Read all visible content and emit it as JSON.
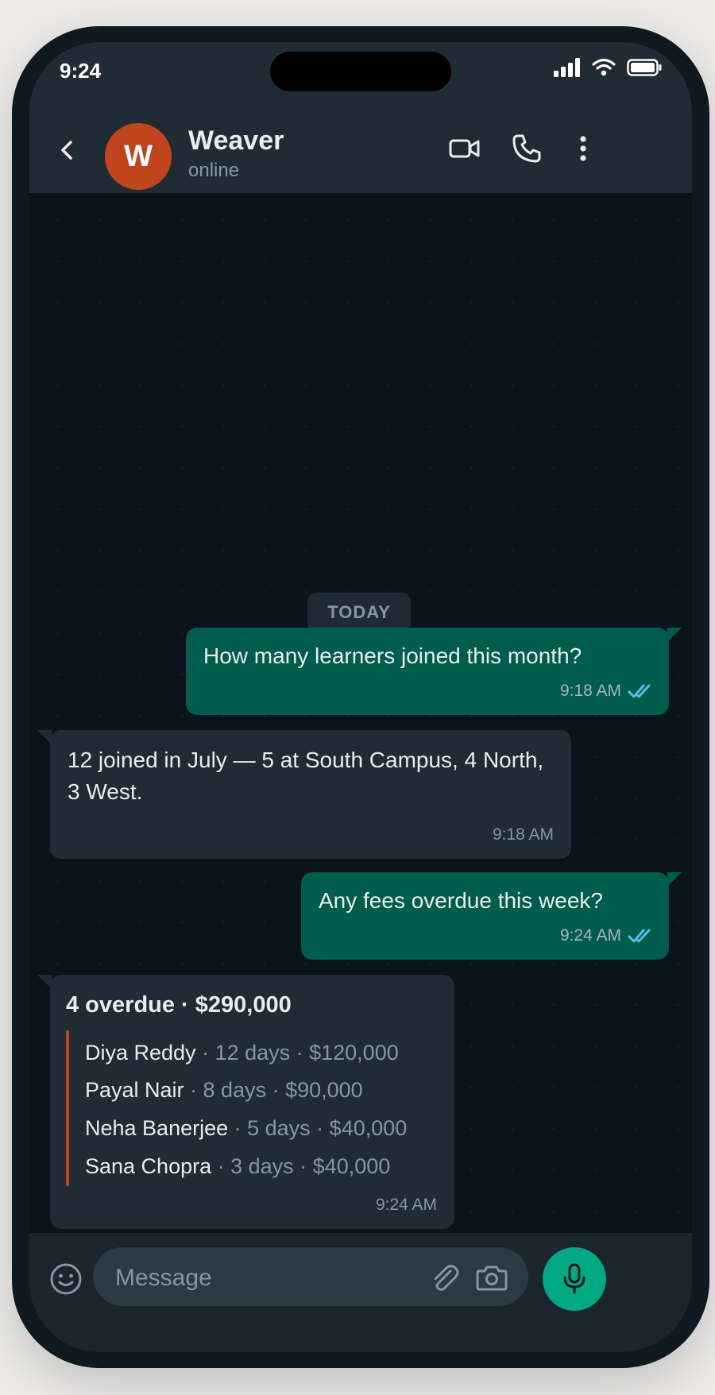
{
  "status_bar": {
    "time": "9:24"
  },
  "header": {
    "avatar_letter": "W",
    "contact_name": "Weaver",
    "contact_status": "online",
    "icons": [
      "back-icon",
      "video-call-icon",
      "phone-icon",
      "more-options-icon"
    ],
    "avatar_color": "#c0451e"
  },
  "chat": {
    "date_separator": "TODAY",
    "messages": [
      {
        "direction": "outgoing",
        "text": "How many learners joined this month?",
        "time": "9:18 AM",
        "read": true
      },
      {
        "direction": "incoming",
        "text": "12 joined in July — 5 at South Campus, 4 North, 3 West.",
        "time": "9:18 AM"
      },
      {
        "direction": "outgoing",
        "text": "Any fees overdue this week?",
        "time": "9:24 AM",
        "read": true
      },
      {
        "direction": "incoming",
        "summary": "4 overdue · $290,000",
        "rows": [
          {
            "name": "Diya Reddy",
            "details": " · 12 days · $120,000"
          },
          {
            "name": "Payal Nair",
            "details": " · 8 days · $90,000"
          },
          {
            "name": "Neha Banerjee",
            "details": " · 5 days · $40,000"
          },
          {
            "name": "Sana Chopra",
            "details": " · 3 days · $40,000"
          }
        ],
        "time": "9:24 AM"
      }
    ]
  },
  "composer": {
    "placeholder": "Message",
    "icons": [
      "emoji-icon",
      "attach-icon",
      "camera-icon",
      "microphone-icon"
    ]
  },
  "colors": {
    "outgoing_bubble": "#005c4b",
    "incoming_bubble": "#202c33",
    "accent": "#00a884",
    "read_ticks": "#53bdeb",
    "quote_bar": "#c0451e"
  }
}
